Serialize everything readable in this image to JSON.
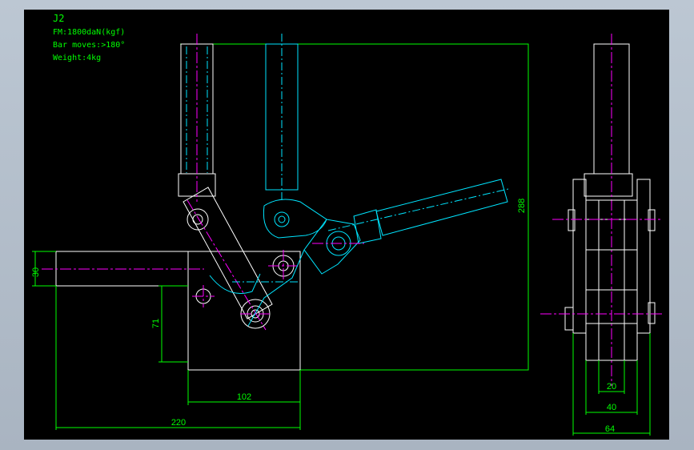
{
  "notes": {
    "model": "J2",
    "force": "FM:1800daN(kgf)",
    "movement": "Bar moves:>180°",
    "weight": "Weight:4kg"
  },
  "dimensions": {
    "d30": "30",
    "d71": "71",
    "d102": "102",
    "d220": "220",
    "d288": "288",
    "d20": "20",
    "d40": "40",
    "d64": "64"
  },
  "colors": {
    "background": "#000000",
    "outline": "#ffffff",
    "alternate_position": "#00e5ff",
    "centerline": "#ff00ff",
    "dimension": "#00ff00"
  }
}
